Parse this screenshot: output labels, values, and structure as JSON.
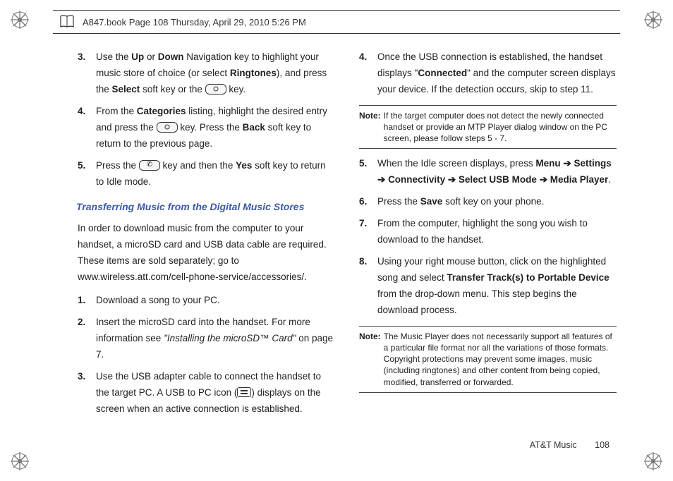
{
  "header": {
    "text": "A847.book  Page 108  Thursday, April 29, 2010  5:26 PM"
  },
  "left": {
    "items_a": [
      {
        "n": "3.",
        "pre": "Use the ",
        "b1": "Up",
        "mid1": " or ",
        "b2": "Down",
        "mid2": " Navigation key to highlight your music store of choice (or select ",
        "b3": "Ringtones",
        "mid3": "), and press the ",
        "b4": "Select",
        "tail": " soft key or the ",
        "keytype": "dot",
        "after_key": " key."
      },
      {
        "n": "4.",
        "pre": "From the ",
        "b1": "Categories",
        "mid1": " listing, highlight the desired entry and press the ",
        "keytype": "dot",
        "mid2": " key. Press the ",
        "b2": "Back",
        "tail": " soft key to return to the previous page."
      },
      {
        "n": "5.",
        "pre": "Press the ",
        "keytype": "end",
        "mid1": " key and then the ",
        "b1": "Yes",
        "tail": " soft key to return to Idle mode."
      }
    ],
    "section_title": "Transferring Music from the Digital Music Stores",
    "intro": "In order to download music from the computer to your handset, a microSD card and USB data cable are required. These items are sold separately; go to www.wireless.att.com/cell-phone-service/accessories/.",
    "items_b": [
      {
        "n": "1.",
        "text": "Download a song to your PC."
      },
      {
        "n": "2.",
        "pre": "Insert the microSD card into the handset. For more information see ",
        "i1": "\"Installing the microSD™ Card\"",
        "tail": " on page 7."
      },
      {
        "n": "3.",
        "pre": "Use the USB adapter cable to connect the handset to the target PC. A USB to PC icon (",
        "icon": "usb",
        "tail": ") displays on the screen when an active connection is established."
      }
    ]
  },
  "right": {
    "items_c": [
      {
        "n": "4.",
        "pre": "Once the USB connection is established, the handset displays \"",
        "b1": "Connected",
        "tail": "\" and the computer screen displays your device. If the detection occurs, skip to step 11."
      }
    ],
    "note1": {
      "label": "Note:",
      "text": "If the target computer does not detect the newly connected handset or provide an MTP Player dialog window on the PC screen, please follow steps 5 - 7."
    },
    "items_d": [
      {
        "n": "5.",
        "pre": "When the Idle screen displays, press ",
        "b1": "Menu",
        "a1": " ➔ ",
        "b2": "Settings",
        "a2": " ➔ ",
        "b3": "Connectivity",
        "a3": " ➔ ",
        "b4": "Select USB Mode",
        "a4": " ➔ ",
        "b5": "Media Player",
        "tail": "."
      },
      {
        "n": "6.",
        "pre": "Press the ",
        "b1": "Save",
        "tail": " soft key on your phone."
      },
      {
        "n": "7.",
        "text": "From the computer, highlight the song you wish to download to the handset."
      },
      {
        "n": "8.",
        "pre": "Using your right mouse button, click on the highlighted song and select ",
        "b1": "Transfer Track(s) to Portable Device",
        "tail": " from the drop-down menu. This step begins the download process."
      }
    ],
    "note2": {
      "label": "Note:",
      "text": "The Music Player does not necessarily support all features of a particular file format nor all the variations of those formats. Copyright protections may prevent some images, music (including ringtones) and other content from being copied, modified, transferred or forwarded."
    }
  },
  "footer": {
    "section": "AT&T Music",
    "page": "108"
  }
}
